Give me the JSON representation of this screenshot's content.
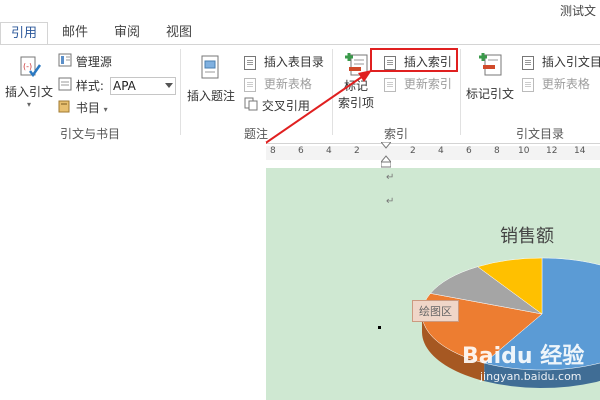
{
  "window": {
    "title_partial": "测试文"
  },
  "tabs": [
    {
      "label": "引用",
      "active": true
    },
    {
      "label": "邮件",
      "active": false
    },
    {
      "label": "审阅",
      "active": false
    },
    {
      "label": "视图",
      "active": false
    }
  ],
  "ribbon": {
    "citations_group": {
      "label": "引文与书目",
      "insert_citation": "插入引文",
      "manage_sources": "管理源",
      "style_label": "样式:",
      "style_value": "APA",
      "bibliography": "书目"
    },
    "captions_group": {
      "label": "题注",
      "insert_caption": "插入题注",
      "insert_table_of_figures": "插入表目录",
      "update_table": "更新表格",
      "cross_reference": "交叉引用"
    },
    "index_group": {
      "label": "索引",
      "mark_entry_line1": "标记",
      "mark_entry_line2": "索引项",
      "insert_index": "插入索引",
      "update_index": "更新索引"
    },
    "toa_group": {
      "label": "引文目录",
      "mark_citation": "标记引文",
      "insert_toa": "插入引文目",
      "update_table": "更新表格"
    }
  },
  "ruler": {
    "ticks": [
      "8",
      "6",
      "4",
      "2",
      "2",
      "4",
      "6",
      "8",
      "10",
      "12",
      "14"
    ]
  },
  "chart": {
    "title": "销售额",
    "plot_area_label": "绘图区"
  },
  "chart_data": {
    "type": "pie",
    "title": "销售额",
    "values": [
      58,
      23,
      10,
      9
    ],
    "colors": [
      "#5b9bd5",
      "#ed7d31",
      "#a5a5a5",
      "#ffc000"
    ]
  },
  "watermark": {
    "text": "Baidu 经验",
    "sub": "jingyan.baidu.com"
  },
  "colors": {
    "accent": "#2b579a",
    "highlight": "#e02020",
    "page_bg": "#cfe8d2"
  }
}
